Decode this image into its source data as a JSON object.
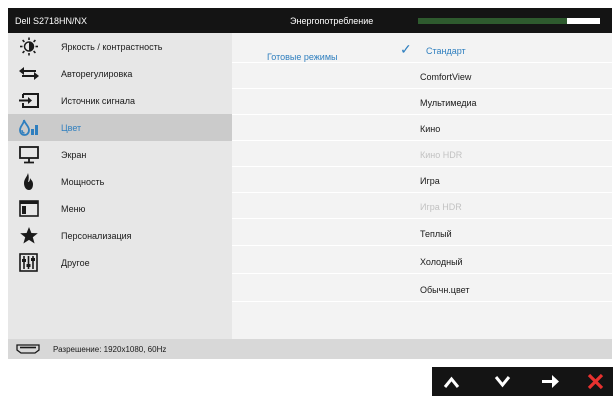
{
  "header": {
    "model": "Dell S2718HN/NX",
    "energy_label": "Энергопотребление",
    "energy_level": 0.82
  },
  "sidebar": {
    "items": [
      {
        "label": "Яркость / контрастность",
        "icon": "brightness-contrast-icon"
      },
      {
        "label": "Авторегулировка",
        "icon": "auto-adjust-icon"
      },
      {
        "label": "Источник сигнала",
        "icon": "input-source-icon"
      },
      {
        "label": "Цвет",
        "icon": "color-icon",
        "active": true
      },
      {
        "label": "Экран",
        "icon": "display-icon"
      },
      {
        "label": "Мощность",
        "icon": "power-icon"
      },
      {
        "label": "Меню",
        "icon": "menu-icon"
      },
      {
        "label": "Персонализация",
        "icon": "personalize-icon"
      },
      {
        "label": "Другое",
        "icon": "others-icon"
      }
    ]
  },
  "content": {
    "section_label": "Готовые режимы",
    "presets": [
      {
        "label": "Стандарт",
        "selected": true
      },
      {
        "label": "ComfortView"
      },
      {
        "label": "Мультимедиа"
      },
      {
        "label": "Кино"
      },
      {
        "label": "Кино HDR",
        "disabled": true
      },
      {
        "label": "Игра"
      },
      {
        "label": "Игра HDR",
        "disabled": true
      },
      {
        "label": "Теплый"
      },
      {
        "label": "Холодный"
      },
      {
        "label": "Обычн.цвет"
      }
    ]
  },
  "status": {
    "icon": "hdmi-port-icon",
    "resolution": "Разрешение: 1920x1080, 60Hz"
  },
  "nav": {
    "buttons": [
      "up-arrow-icon",
      "down-arrow-icon",
      "right-arrow-icon",
      "close-icon"
    ],
    "colors": {
      "close": "#e8312f",
      "arrows": "#ffffff"
    }
  },
  "colors": {
    "accent": "#2f7fbf",
    "header_bg": "#141414",
    "energy_fill": "#2e5a2e",
    "active_row": "#cbcbcb"
  }
}
